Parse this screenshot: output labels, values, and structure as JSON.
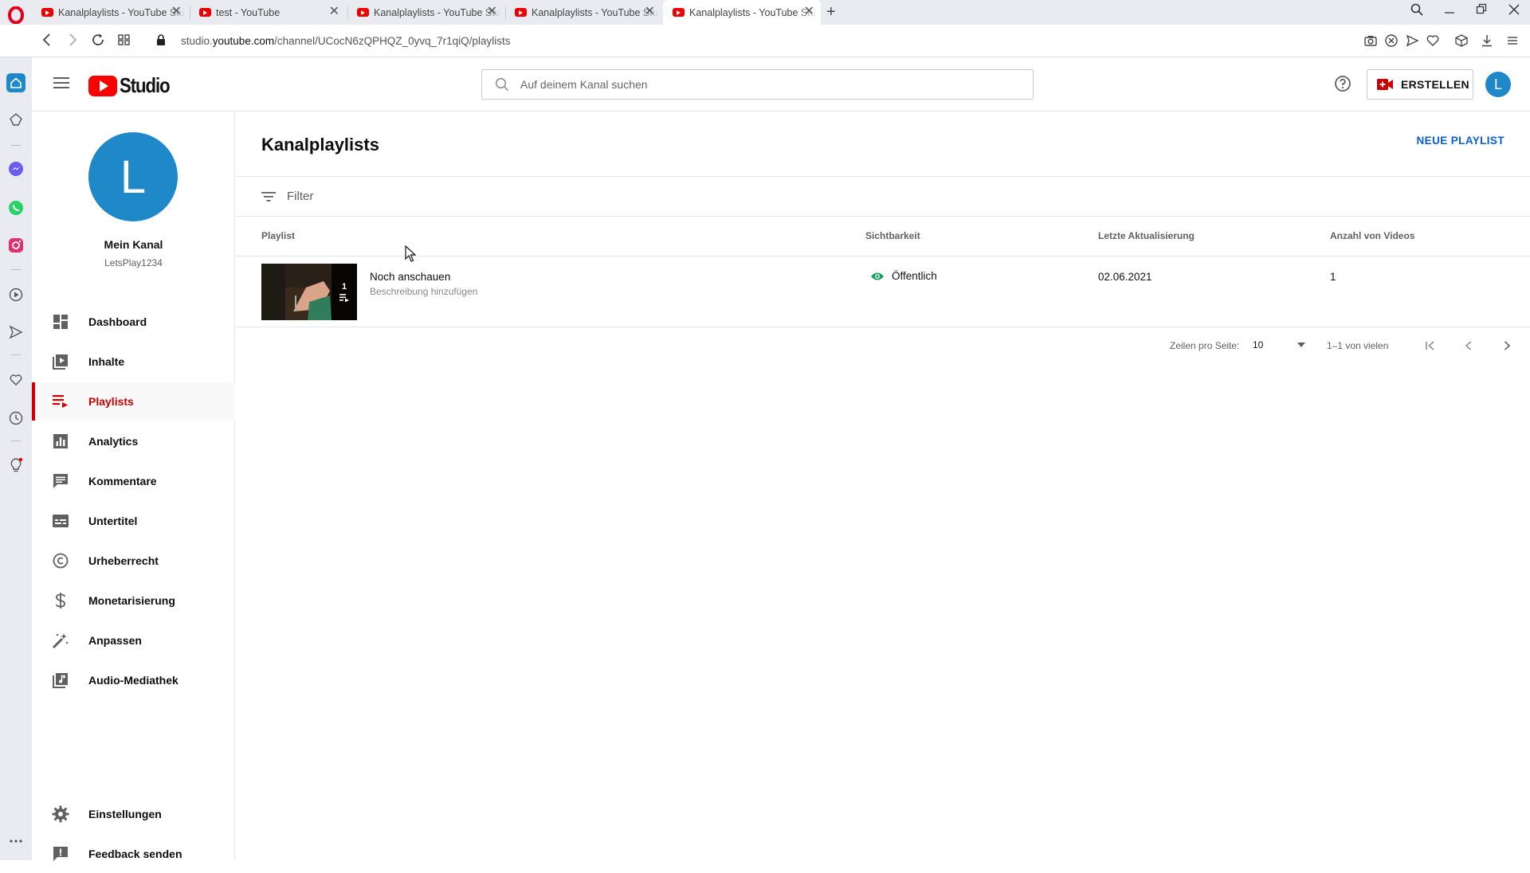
{
  "browser": {
    "tabs": [
      {
        "title": "Kanalplaylists - YouTube Studio",
        "active": false
      },
      {
        "title": "test - YouTube",
        "active": false
      },
      {
        "title": "Kanalplaylists - YouTube Studio",
        "active": false
      },
      {
        "title": "Kanalplaylists - YouTube Studio",
        "active": false
      },
      {
        "title": "Kanalplaylists - YouTube Studio",
        "active": true
      }
    ],
    "url_prefix": "studio.",
    "url_domain": "youtube.com",
    "url_path": "/channel/UCocN6zQPHQZ_0yvq_7r1qiQ/playlists"
  },
  "header": {
    "logo_text": "Studio",
    "search_placeholder": "Auf deinem Kanal suchen",
    "create_label": "ERSTELLEN",
    "avatar_letter": "L"
  },
  "channel": {
    "avatar_letter": "L",
    "name": "Mein Kanal",
    "handle": "LetsPlay1234"
  },
  "nav": {
    "items": [
      {
        "label": "Dashboard",
        "icon": "dashboard-icon"
      },
      {
        "label": "Inhalte",
        "icon": "content-icon"
      },
      {
        "label": "Playlists",
        "icon": "playlists-icon",
        "active": true
      },
      {
        "label": "Analytics",
        "icon": "analytics-icon"
      },
      {
        "label": "Kommentare",
        "icon": "comments-icon"
      },
      {
        "label": "Untertitel",
        "icon": "subtitles-icon"
      },
      {
        "label": "Urheberrecht",
        "icon": "copyright-icon"
      },
      {
        "label": "Monetarisierung",
        "icon": "dollar-icon"
      },
      {
        "label": "Anpassen",
        "icon": "magic-wand-icon"
      },
      {
        "label": "Audio-Mediathek",
        "icon": "audio-library-icon"
      }
    ],
    "bottom": [
      {
        "label": "Einstellungen",
        "icon": "gear-icon"
      },
      {
        "label": "Feedback senden",
        "icon": "feedback-icon"
      }
    ]
  },
  "main": {
    "title": "Kanalplaylists",
    "new_playlist": "NEUE PLAYLIST",
    "filter_label": "Filter",
    "columns": {
      "playlist": "Playlist",
      "visibility": "Sichtbarkeit",
      "updated": "Letzte Aktualisierung",
      "count": "Anzahl von Videos"
    },
    "rows": [
      {
        "title": "Noch anschauen",
        "description": "Beschreibung hinzufügen",
        "thumb_count": "1",
        "visibility": "Öffentlich",
        "updated": "02.06.2021",
        "count": "1"
      }
    ],
    "pagination": {
      "rows_label": "Zeilen pro Seite:",
      "rows_value": "10",
      "range": "1–1 von vielen"
    }
  },
  "colors": {
    "accent_red": "#cc0000",
    "brand_red": "#ff0000",
    "link_blue": "#065fd4",
    "avatar_blue": "#1e88c8",
    "visibility_green": "#0f9d58"
  }
}
